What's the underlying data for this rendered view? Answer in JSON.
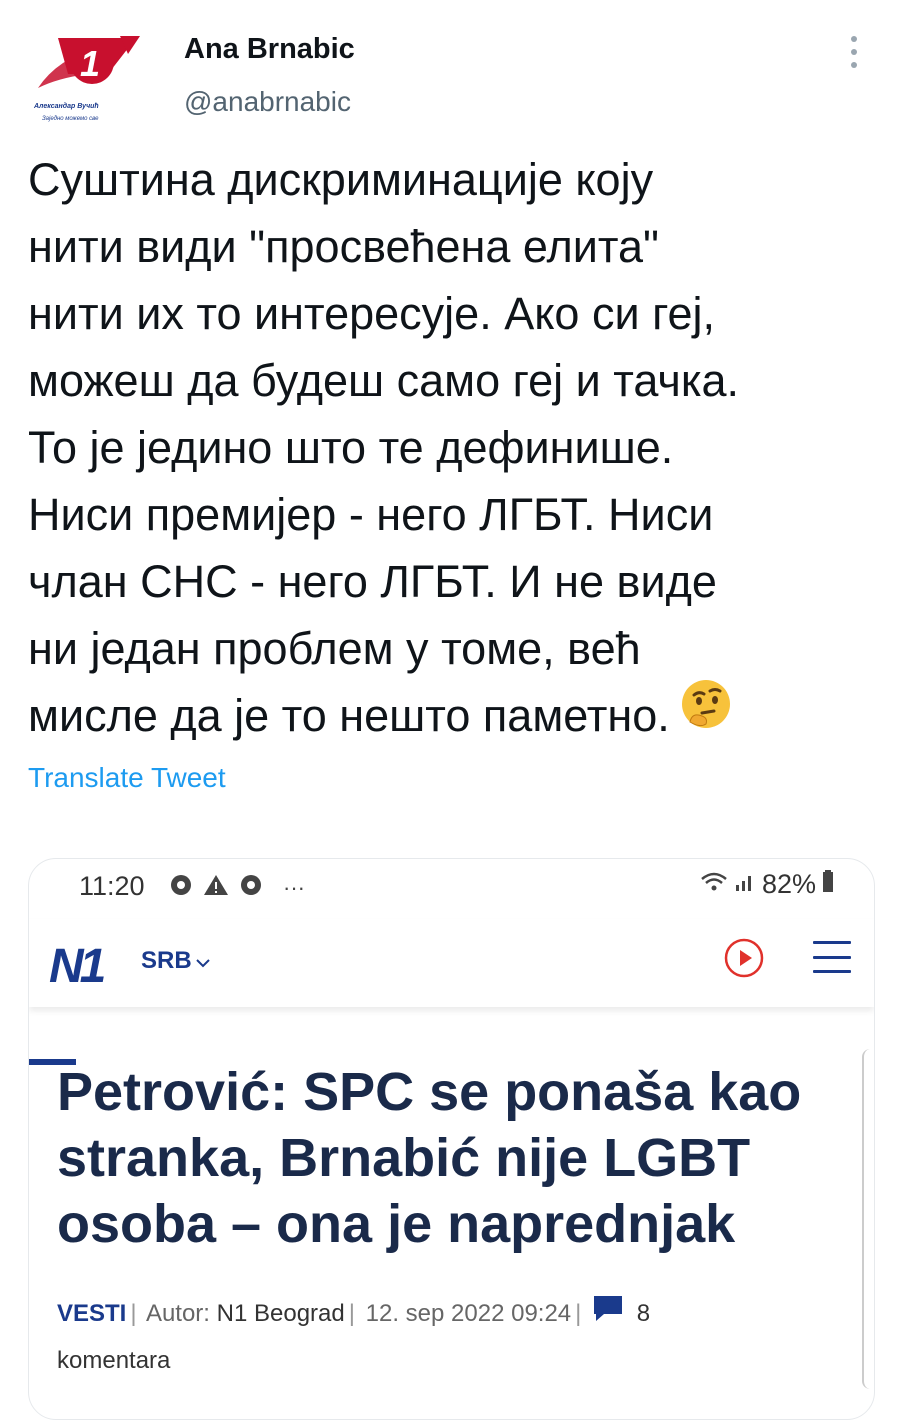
{
  "tweet": {
    "author_name": "Ana Brnabic",
    "handle": "@anabrnabic",
    "avatar_text": [
      "Александар Вучић",
      "Заједно можемо све"
    ],
    "text_lines": [
      "Суштина дискриминације коју",
      "нити види \"просвећена елита\"",
      "нити их то интересује. Ако си геј,",
      "можеш да будеш само геј и тачка.",
      "То је једино што те дефинише.",
      "Ниси премијер - него ЛГБТ. Ниси",
      "члан СНС - него ЛГБТ. И не виде",
      "ни један проблем у томе, већ",
      "мисле да је то нешто паметно."
    ],
    "emoji": "thinking-face",
    "translate_label": "Translate Tweet"
  },
  "screenshot": {
    "status_bar": {
      "time": "11:20",
      "battery": "82%",
      "more": "···"
    },
    "site": {
      "logo": "N1",
      "region": "SRB"
    },
    "article": {
      "headline_lines": [
        "Petrović: SPC se ponaša kao",
        "stranka, Brnabić nije LGBT",
        "osoba – ona je naprednjak"
      ],
      "category": "VESTI",
      "author_label": "Autor:",
      "author": "N1 Beograd",
      "date": "12. sep 2022 09:24",
      "comments_count": "8",
      "comments_label": "komentara"
    },
    "colors": {
      "brand": "#1a3a8c",
      "play": "#e0312b"
    }
  },
  "colors": {
    "link": "#1d9bf0",
    "text": "#0f1419",
    "secondary": "#536471"
  }
}
